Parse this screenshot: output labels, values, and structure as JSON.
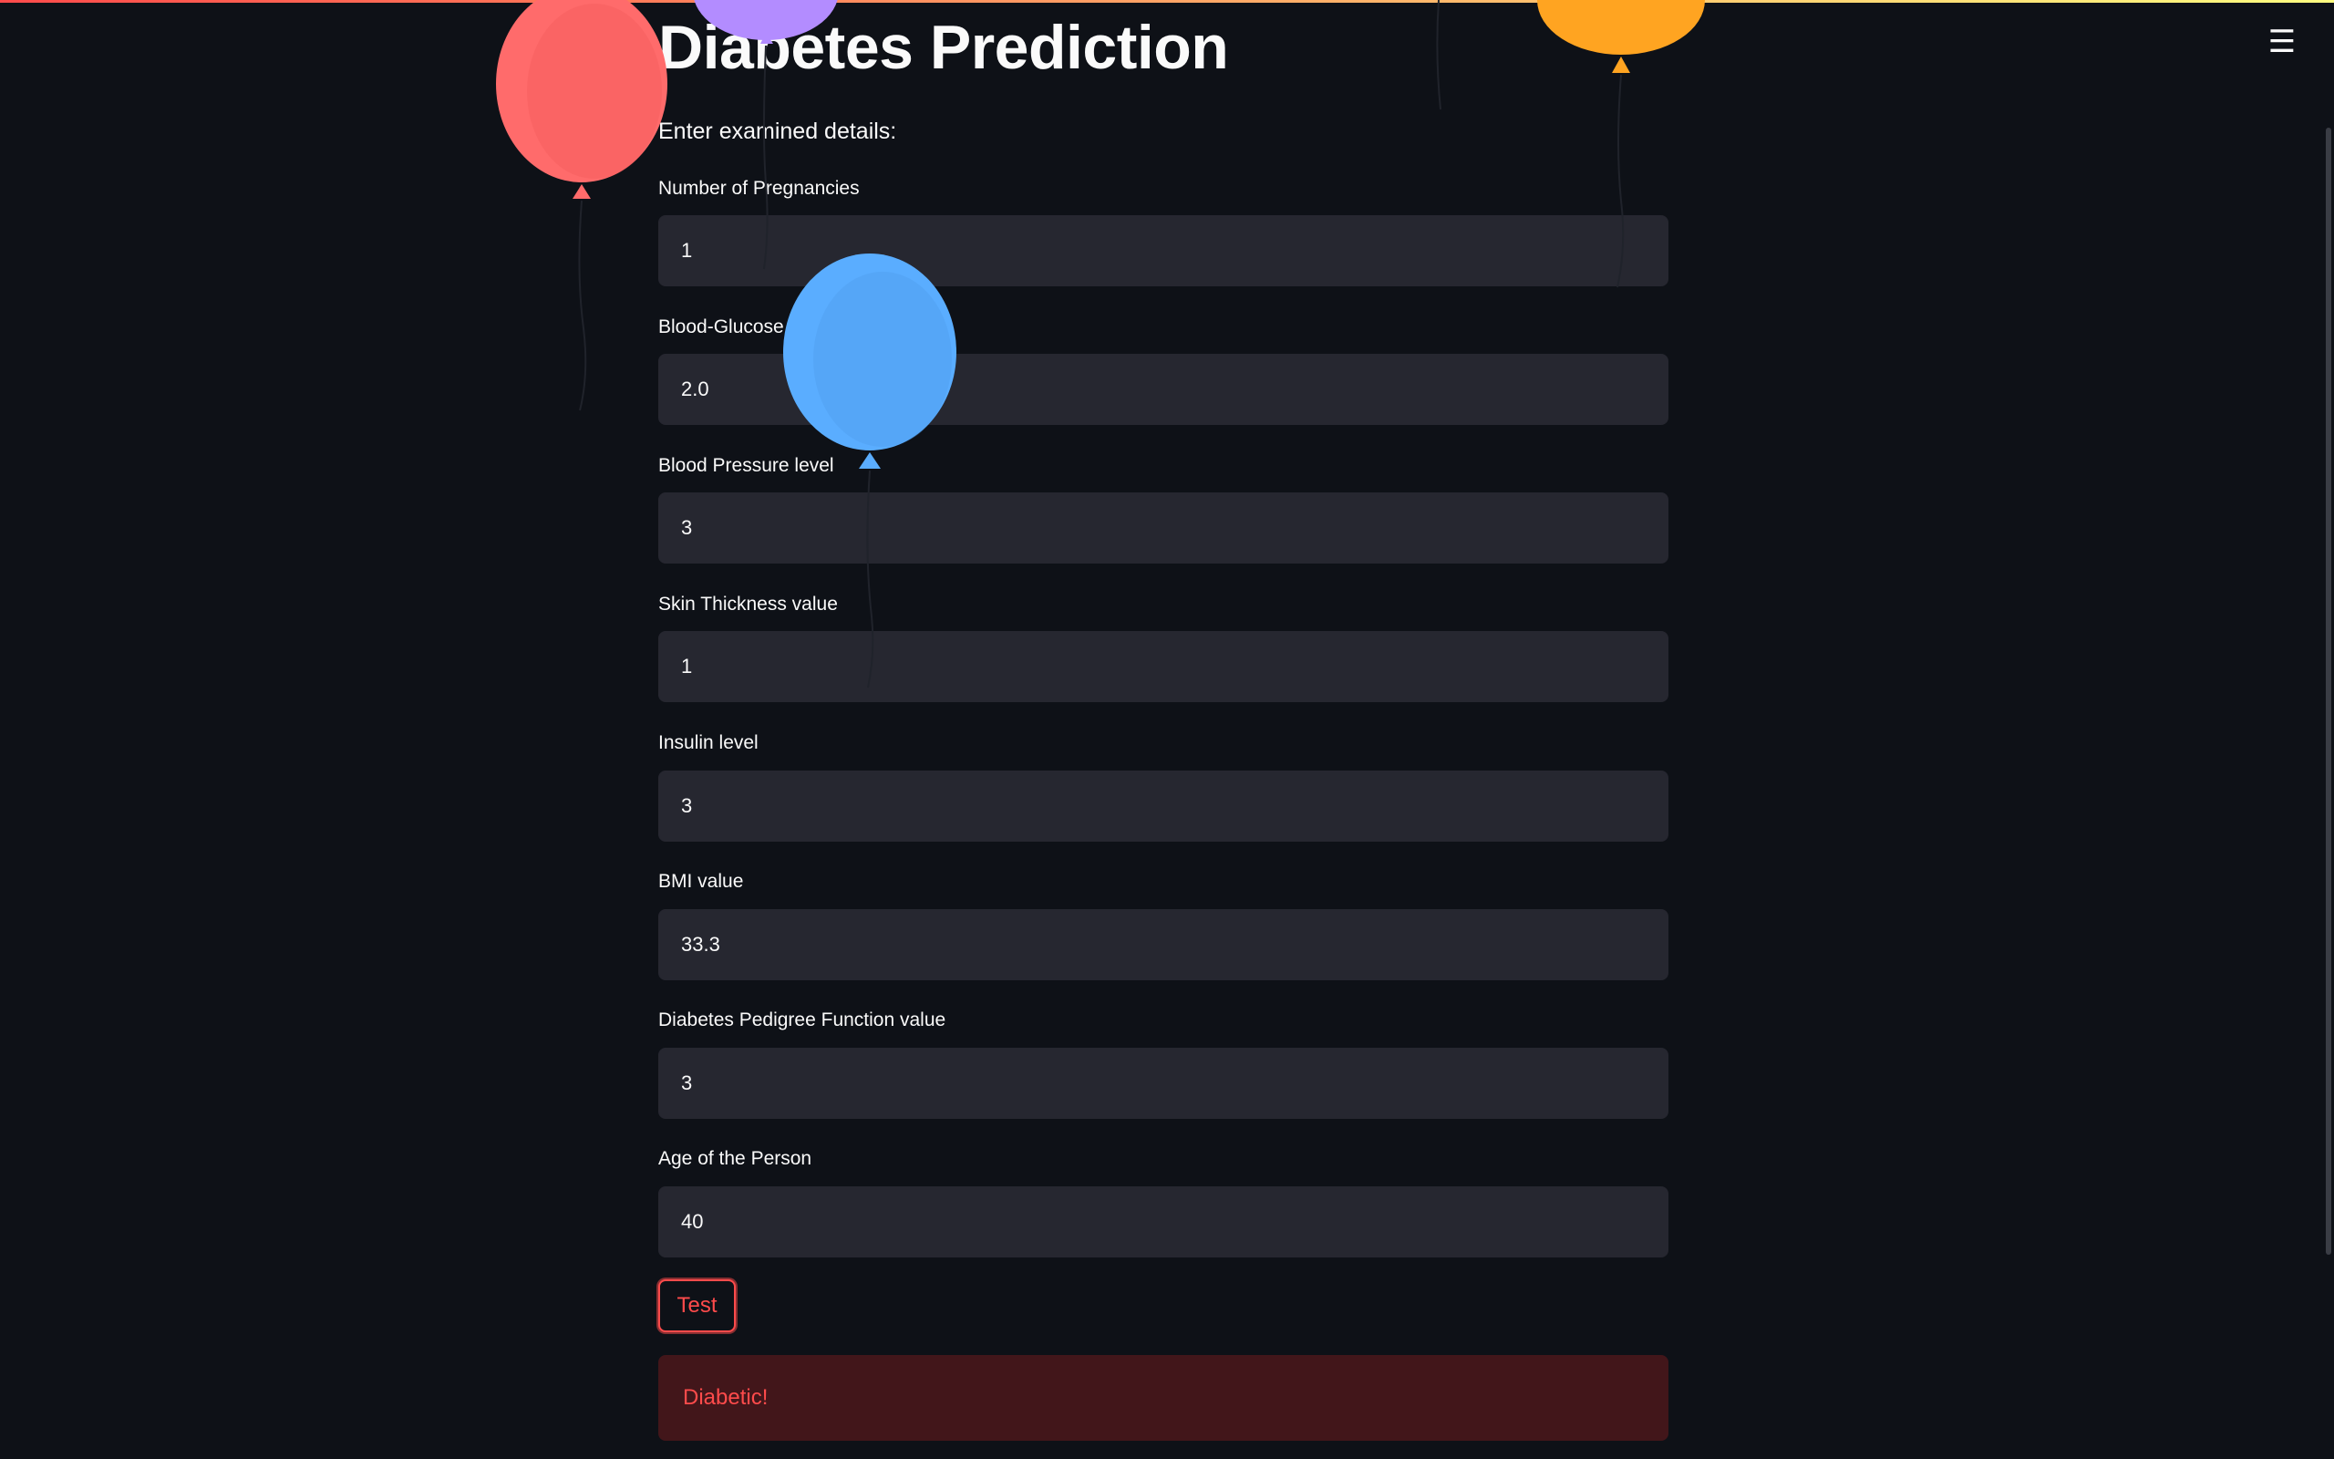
{
  "page": {
    "title": "Diabetes Prediction",
    "subheader": "Enter examined details:"
  },
  "fields": [
    {
      "label": "Number of Pregnancies",
      "value": "1"
    },
    {
      "label": "Blood-Glucose level",
      "value": "2.0"
    },
    {
      "label": "Blood Pressure level",
      "value": "3"
    },
    {
      "label": "Skin Thickness value",
      "value": "1"
    },
    {
      "label": "Insulin level",
      "value": "3"
    },
    {
      "label": "BMI value",
      "value": "33.3"
    },
    {
      "label": "Diabetes Pedigree Function value",
      "value": "3"
    },
    {
      "label": "Age of the Person",
      "value": "40"
    }
  ],
  "actions": {
    "test_label": "Test"
  },
  "result": {
    "message": "Diabetic!"
  },
  "header": {
    "menu_icon": "hamburger-menu-icon"
  },
  "colors": {
    "background": "#0e1117",
    "input_background": "#262730",
    "accent": "#ff4b4b",
    "balloons": [
      "#ff6b6b",
      "#b38cff",
      "#ffa421",
      "#5aadff"
    ]
  }
}
